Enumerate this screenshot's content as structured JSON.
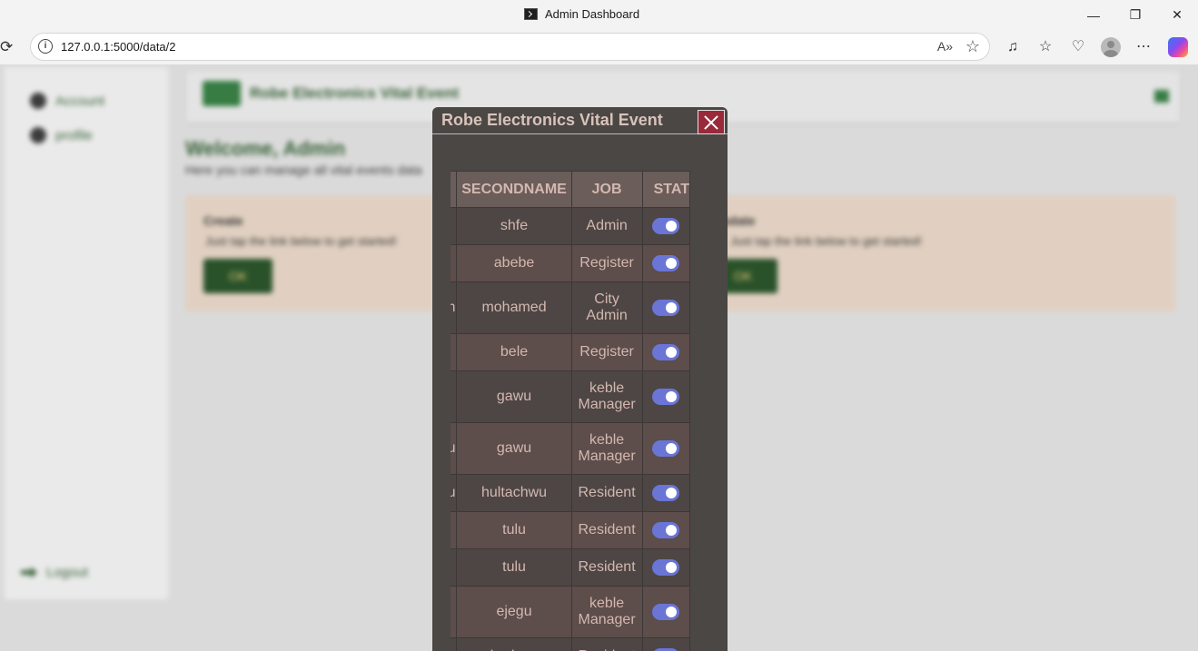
{
  "browser": {
    "window_title": "Admin Dashboard",
    "url": "127.0.0.1:5000/data/2",
    "minimize": "—",
    "restore": "❐",
    "close": "✕"
  },
  "sidebar": {
    "items": [
      {
        "label": "Account"
      },
      {
        "label": "profile"
      }
    ],
    "logout_label": "Logout"
  },
  "header": {
    "brand": "Robe Electronics Vital Event"
  },
  "main": {
    "welcome": "Welcome, Admin",
    "subtitle": "Here you can manage all vital events data",
    "cards": [
      {
        "title": "Create",
        "desc": "Just tap the link below to get started!",
        "button": "OK"
      },
      {
        "title": "Update",
        "desc": "Just tap the link below to get started!",
        "button": "OK"
      }
    ]
  },
  "modal": {
    "title": "Robe Electronics Vital Event",
    "columns": {
      "firstname": "",
      "secondname": "SECONDNAME",
      "job": "JOB",
      "status": "STAT"
    },
    "rows": [
      {
        "first": "",
        "second": "shfe",
        "job": "Admin",
        "status_on": true
      },
      {
        "first": "",
        "second": "abebe",
        "job": "Register",
        "status_on": true
      },
      {
        "first": "m",
        "second": "mohamed",
        "job": "City Admin",
        "status_on": true
      },
      {
        "first": "",
        "second": "bele",
        "job": "Register",
        "status_on": true
      },
      {
        "first": "",
        "second": "gawu",
        "job": "keble Manager",
        "status_on": true
      },
      {
        "first": "u",
        "second": "gawu",
        "job": "keble Manager",
        "status_on": true
      },
      {
        "first": "u",
        "second": "hultachwu",
        "job": "Resident",
        "status_on": true
      },
      {
        "first": "",
        "second": "tulu",
        "job": "Resident",
        "status_on": true
      },
      {
        "first": "",
        "second": "tulu",
        "job": "Resident",
        "status_on": true
      },
      {
        "first": "",
        "second": "ejegu",
        "job": "keble Manager",
        "status_on": true
      },
      {
        "first": "",
        "second": "bedasa",
        "job": "Resident",
        "status_on": true
      }
    ]
  },
  "colors": {
    "modal_bg": "#4b4745",
    "header_row": "#6a5d5a",
    "toggle_on": "#6a75d6",
    "close_button": "#9a2a3a"
  }
}
